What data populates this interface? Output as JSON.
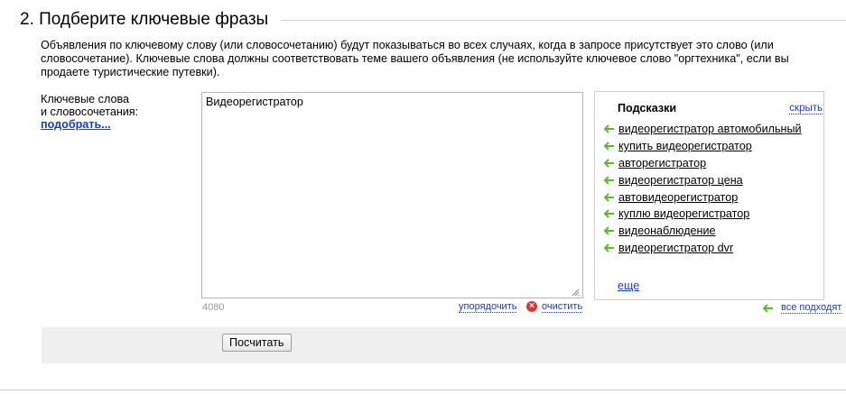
{
  "section": {
    "title": "2. Подберите ключевые фразы",
    "description": "Объявления по ключевому слову (или словосочетанию) будут показываться во всех случаях, когда в запросе присутствует это слово (или словосочетание). Ключевые слова должны соответствовать теме вашего объявления (не используйте ключевое слово \"оргтехника\", если вы продаете туристические путевки)."
  },
  "keywords": {
    "label_line1": "Ключевые слова",
    "label_line2": "и словосочетания:",
    "pick_link": "подобрать...",
    "value": "Видеорегистратор",
    "char_count": "4080",
    "sort_link": "упорядочить",
    "clear_link": "очистить"
  },
  "hints": {
    "title": "Подсказки",
    "hide_link": "скрыть",
    "items": [
      "видеорегистратор автомобильный",
      "купить видеорегистратор",
      "авторегистратор",
      "видеорегистратор цена",
      "автовидеорегистратор",
      "куплю видеорегистратор",
      "видеонаблюдение",
      "видеорегистратор dvr"
    ],
    "more_link": "еще",
    "all_fit_link": "все подходят"
  },
  "actions": {
    "calculate_button": "Посчитать"
  },
  "colors": {
    "link": "#1a3dc1",
    "arrow": "#5cb82e",
    "clear_icon": "#e0352b",
    "bar_bg": "#efefef"
  },
  "icons": {
    "hint_arrow": "arrow-left-icon",
    "clear": "close-circle-icon",
    "resize": "resize-grip-icon"
  }
}
